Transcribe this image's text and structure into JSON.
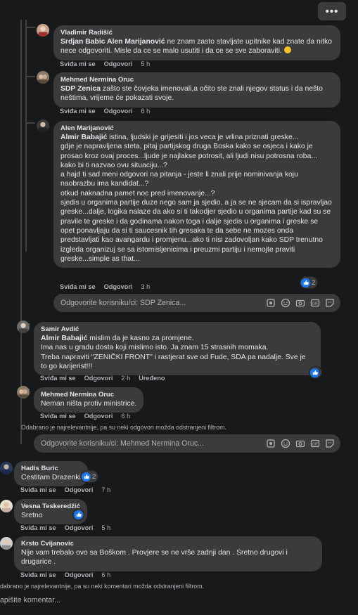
{
  "top_menu": {
    "label": "•••"
  },
  "actions": {
    "like": "Sviđa mi se",
    "reply": "Odgovori",
    "edited": "Uređeno"
  },
  "comments": [
    {
      "author": "Vladimir Radišić",
      "mention": "Srdjan Babic Alen Marijanović",
      "text": " ne znam zasto stavljate upitnike kad znate da nitko nece odgovoriti. Misle da ce se malo usutiti i da ce se sve zaboraviti. ",
      "time": "5 h"
    },
    {
      "author": "Mehmed Nermina Oruc",
      "mention": "SDP Zenica",
      "text": " zašto ste čovjeka imenovali,a očito ste znali njegov status i da nešto neštima, vrijeme će pokazati svoje.",
      "time": "6 h"
    },
    {
      "author": "Alen Marijanović",
      "mention": "Almir Babajić",
      "text": " istina, ljudski je grijesiti i jos veca je vrlina priznati greske...\ngdje je napravljena steta, pitaj partijskog druga Boska kako se osjeca i kako je prosao kroz ovaj proces...ljude je najlakse potrosit, ali ljudi nisu potrosna roba...\nkako bi ti nazvao ovu situaciju...?\na hajd ti sad meni odgovori na pitanja - jeste li znali prije nominivanja koju naobrazbu ima kandidat...?\notkud naknadna pamet noc pred imenovanje...?\nsjedis u organima partije duze nego sam ja sjedio, a ja se ne sjecam da si ispravljao greske...dalje, logika nalaze da ako si ti takodjer sjedio u organima partije kad su se pravile te greske i da godinama nakon toga i dalje sjedis u organima i greske se opet ponavljaju da si ti saucesnik tih gresaka te da sebe ne mozes onda predstavljati kao avangardu i promjenu...ako ti nisi zadovoljan kako SDP trenutno izgleda organizuj se sa istomisljenicima i preuzmi partiju i nemojte praviti greske...simple as that...",
      "time": "3 h",
      "reactions": "2"
    },
    {
      "author": "Samir Avdić",
      "mention": "Almir Babajić",
      "text": " mislim da je kasno za promjene.\nIma nas u gradu dosta koji mislimo isto. Ja znam 15 strasnih momaka.\nTreba napraviti \"ZENIČKI FRONT\" i rastjerat sve od Fude, SDA pa nadalje. Sve je to go karijerist!!!",
      "time": "2 h"
    },
    {
      "author": "Mehmed Nermina Oruc",
      "mention": "",
      "text": "Neman ništa protiv ministrice.",
      "time": "6 h"
    },
    {
      "author": "Hadis Buric",
      "mention": "",
      "text": "Cestitam Drazenki",
      "time": "7 h",
      "reactions": "2"
    },
    {
      "author": "Vesna Teskeredžić",
      "mention": "",
      "text": "Sretno",
      "time": "5 h"
    },
    {
      "author": "Krsto Cvijanovic",
      "mention": "",
      "text": "Nije vam trebalo ovo sa Boškom . Provjere se ne vrše zadnji dan . Sretno drugovi i drugarice .",
      "time": "6 h"
    }
  ],
  "reply_boxes": [
    {
      "placeholder": "Odgovorite korisniku/ci: SDP Zenica..."
    },
    {
      "placeholder": "Odgovorite korisniku/ci: Mehmed Nermina Oruc..."
    }
  ],
  "filter_notes": {
    "replies": "Odabrano je najrelevantnije, pa su neki odgovori možda odstranjeni filtrom.",
    "comments": "dabrano je najrelevantnije, pa su neki komentari možda odstranjeni filtrom."
  },
  "write_comment": {
    "placeholder": "apišite komentar..."
  },
  "colors": {
    "background": "#18191a",
    "bubble": "#3a3b3c",
    "like_blue": "#1877f2",
    "secondary_text": "#b0b3b8"
  }
}
